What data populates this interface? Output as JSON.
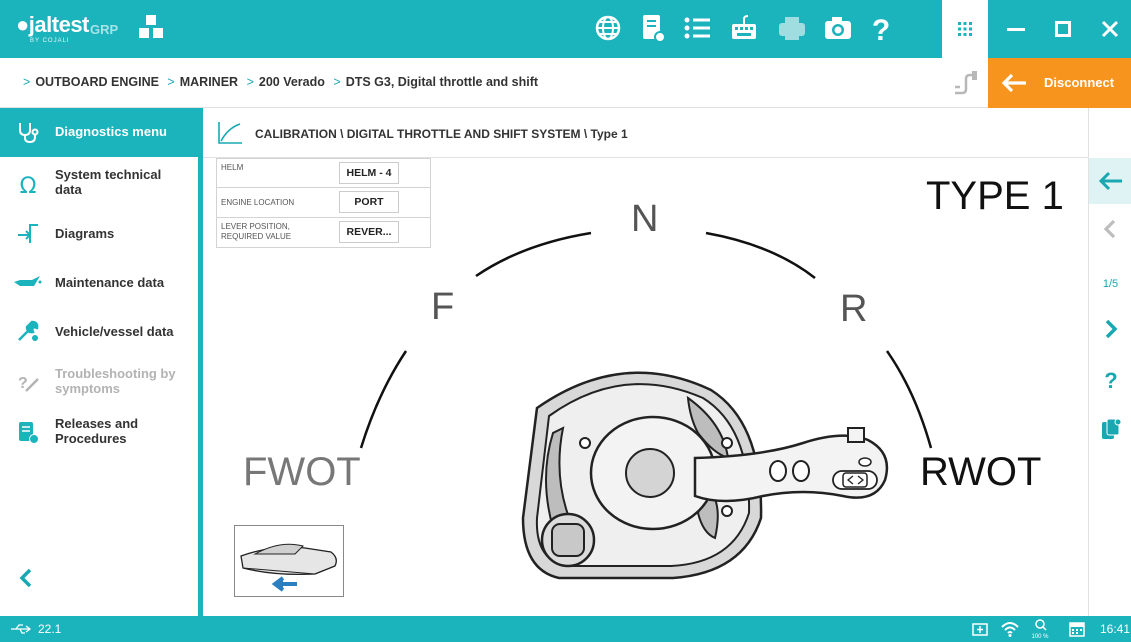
{
  "app": {
    "logo_text": "jaltest",
    "logo_sub": "BY COJALI",
    "product": "GRP"
  },
  "breadcrumb": [
    "OUTBOARD ENGINE",
    "MARINER",
    "200 Verado",
    "DTS G3, Digital throttle and shift"
  ],
  "disconnect_label": "Disconnect",
  "sidebar": {
    "items": [
      {
        "label": "Diagnostics menu",
        "icon": "stethoscope-icon",
        "active": true,
        "enabled": true
      },
      {
        "label": "System technical data",
        "icon": "omega-icon",
        "active": false,
        "enabled": true
      },
      {
        "label": "Diagrams",
        "icon": "diagram-arrow-icon",
        "active": false,
        "enabled": true
      },
      {
        "label": "Maintenance data",
        "icon": "oil-can-icon",
        "active": false,
        "enabled": true
      },
      {
        "label": "Vehicle/vessel data",
        "icon": "wrench-icon",
        "active": false,
        "enabled": true
      },
      {
        "label": "Troubleshooting by symptoms",
        "icon": "troubleshoot-icon",
        "active": false,
        "enabled": false
      },
      {
        "label": "Releases and Procedures",
        "icon": "document-globe-icon",
        "active": false,
        "enabled": true
      }
    ]
  },
  "main": {
    "title": "CALIBRATION \\ DIGITAL THROTTLE AND SHIFT SYSTEM \\ Type 1",
    "params": [
      {
        "label": "HELM",
        "value": "HELM - 4"
      },
      {
        "label": "ENGINE LOCATION",
        "value": "PORT"
      },
      {
        "label": "LEVER POSITION, REQUIRED VALUE",
        "value": "REVER..."
      }
    ],
    "diagram": {
      "type_title": "TYPE 1",
      "label_n": "N",
      "label_f": "F",
      "label_r": "R",
      "label_fwot": "FWOT",
      "label_rwot": "RWOT"
    }
  },
  "rightnav": {
    "page": "1/5"
  },
  "status": {
    "version": "22.1",
    "zoom": "100 %",
    "time": "16:41"
  },
  "colors": {
    "accent": "#1bb3bc",
    "disconnect": "#f7941d"
  }
}
